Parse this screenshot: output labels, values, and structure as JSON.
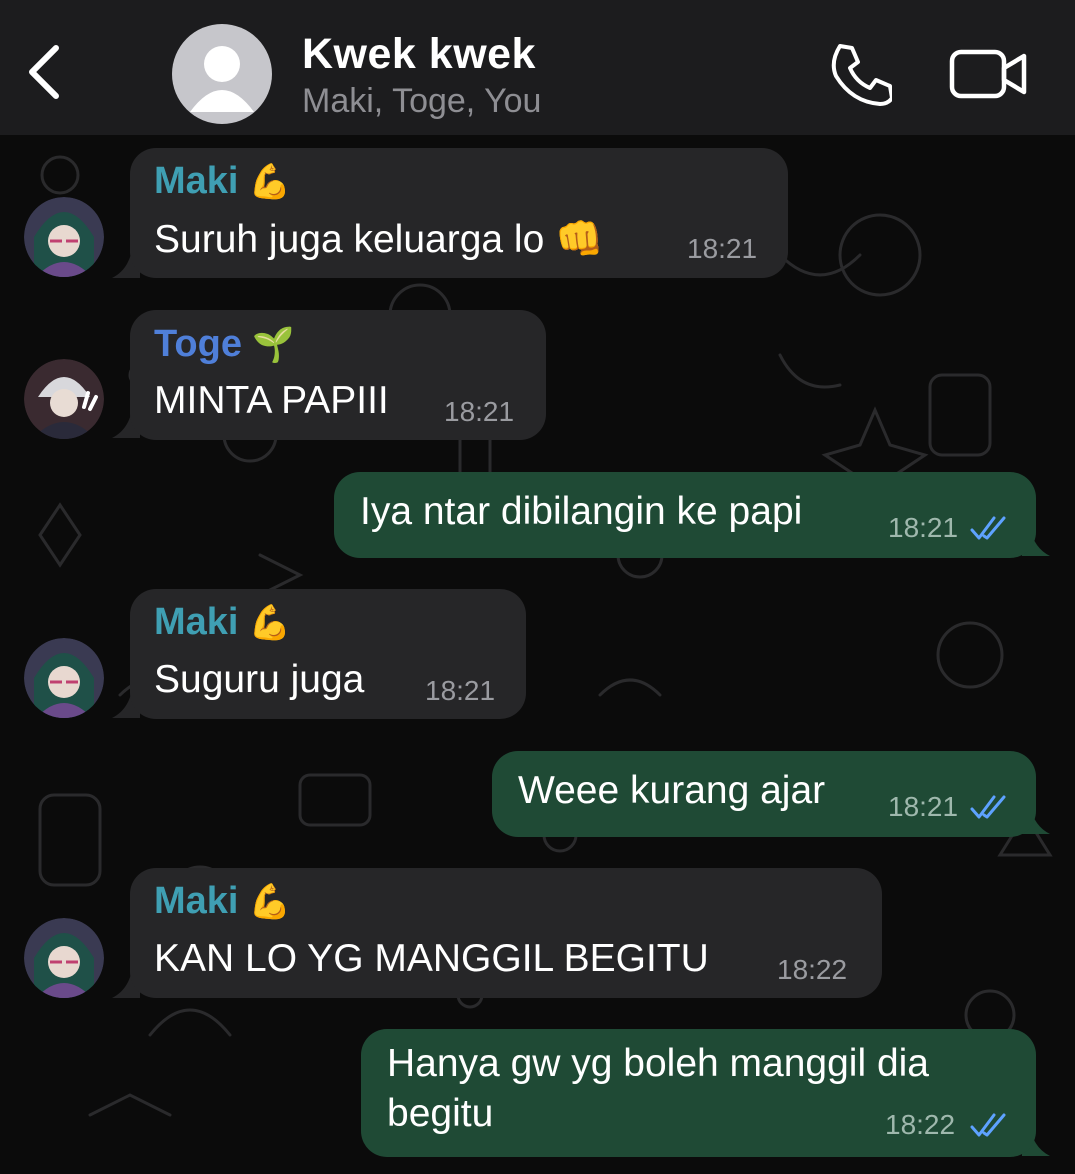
{
  "header": {
    "title": "Kwek kwek",
    "subtitle": "Maki, Toge, You"
  },
  "colors": {
    "maki": "#3f9fb3",
    "toge": "#4f7fd9",
    "outgoing_bubble": "#1f4a35",
    "incoming_bubble": "#262628",
    "read_ticks": "#5ea2ff"
  },
  "messages": [
    {
      "direction": "in",
      "sender": "Maki",
      "sender_emoji": "💪",
      "text": "Suruh juga keluarga lo 👊",
      "time": "18:21"
    },
    {
      "direction": "in",
      "sender": "Toge",
      "sender_emoji": "🌱",
      "text": "MINTA PAPIII",
      "time": "18:21"
    },
    {
      "direction": "out",
      "text": "Iya ntar dibilangin ke papi",
      "time": "18:21",
      "status": "read"
    },
    {
      "direction": "in",
      "sender": "Maki",
      "sender_emoji": "💪",
      "text": "Suguru juga",
      "time": "18:21"
    },
    {
      "direction": "out",
      "text": "Weee kurang ajar",
      "time": "18:21",
      "status": "read"
    },
    {
      "direction": "in",
      "sender": "Maki",
      "sender_emoji": "💪",
      "text": "KAN LO YG MANGGIL BEGITU",
      "time": "18:22"
    },
    {
      "direction": "out",
      "text_line1": "Hanya gw yg boleh manggil dia",
      "text_line2": "begitu",
      "time": "18:22",
      "status": "read"
    }
  ]
}
